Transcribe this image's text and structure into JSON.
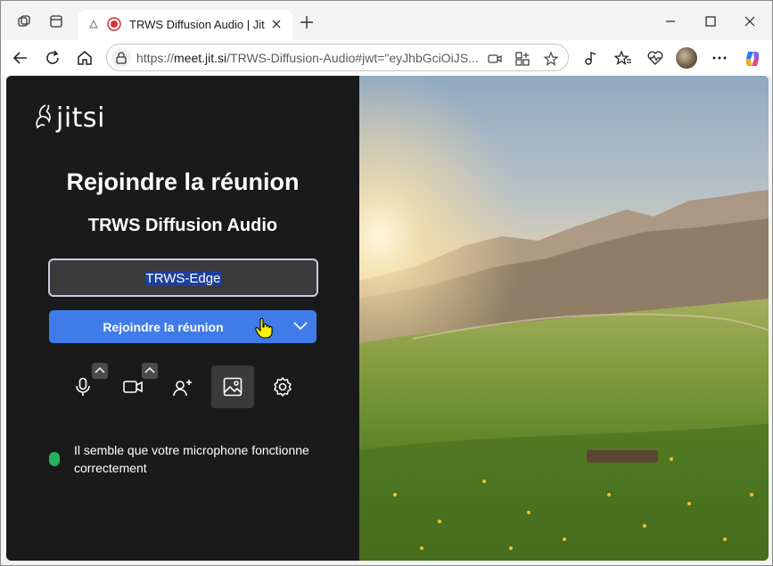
{
  "browser": {
    "tab_title": "TRWS Diffusion Audio | Jitsi Meet",
    "url_prefix": "https://",
    "url_host": "meet.jit.si",
    "url_rest": "/TRWS-Diffusion-Audio#jwt=\"eyJhbGciOiJS..."
  },
  "jitsi": {
    "logo_text": "jitsi",
    "heading": "Rejoindre la réunion",
    "meeting_name": "TRWS Diffusion Audio",
    "name_value": "TRWS-Edge",
    "join_label": "Rejoindre la réunion",
    "status_text": "Il semble que votre microphone fonctionne correctement",
    "status_color": "#27b15f",
    "accent": "#3f7ce8",
    "controls": [
      "microphone-icon",
      "camera-icon",
      "invite-icon",
      "background-icon",
      "settings-icon"
    ]
  }
}
